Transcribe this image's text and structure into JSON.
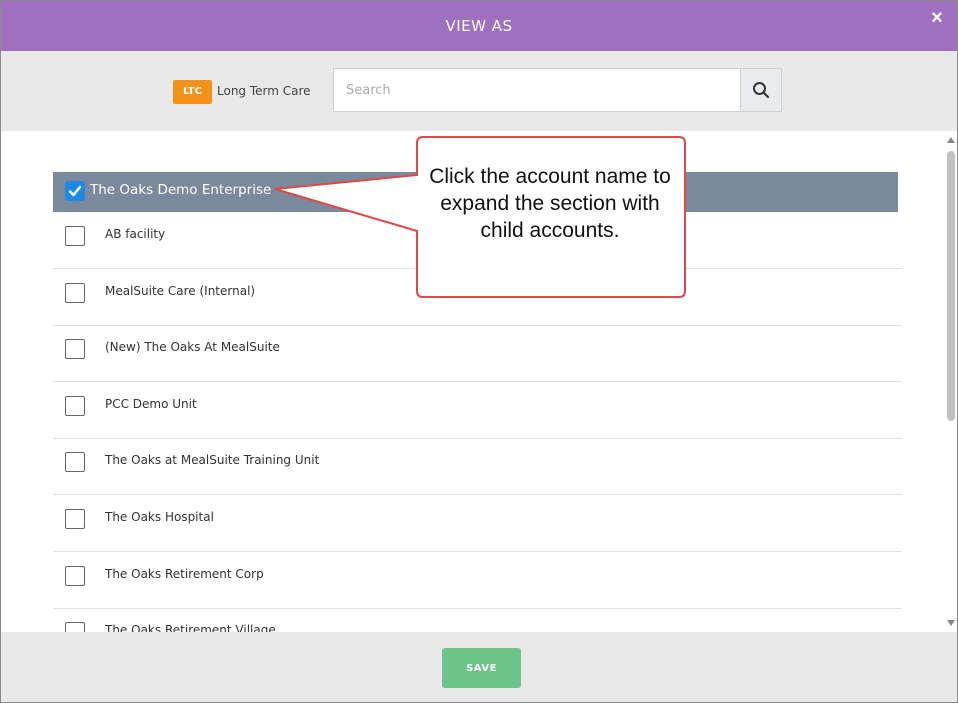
{
  "header": {
    "title": "VIEW AS",
    "close_glyph": "×"
  },
  "toolbar": {
    "badge": "LTC",
    "badge_label": "Long Term Care",
    "badge_color": "#f39219",
    "search_placeholder": "Search",
    "search_icon": "search-icon"
  },
  "group": {
    "label": "The Oaks Demo Enterprise",
    "checked": true
  },
  "items": [
    {
      "label": "AB facility",
      "checked": false
    },
    {
      "label": "MealSuite Care (Internal)",
      "checked": false
    },
    {
      "label": "(New) The Oaks At MealSuite",
      "checked": false
    },
    {
      "label": "PCC Demo Unit",
      "checked": false
    },
    {
      "label": "The Oaks at MealSuite Training Unit",
      "checked": false
    },
    {
      "label": "The Oaks Hospital",
      "checked": false
    },
    {
      "label": "The Oaks Retirement Corp",
      "checked": false
    },
    {
      "label": "The Oaks Retirement Village",
      "checked": false
    }
  ],
  "callout": {
    "text": "Click the account name to expand the section with child accounts."
  },
  "footer": {
    "save_label": "SAVE"
  },
  "colors": {
    "header_bg": "#a070c0",
    "group_bg": "#7a8a9c",
    "save_bg": "#6cc48a",
    "callout_border": "#e04848"
  }
}
